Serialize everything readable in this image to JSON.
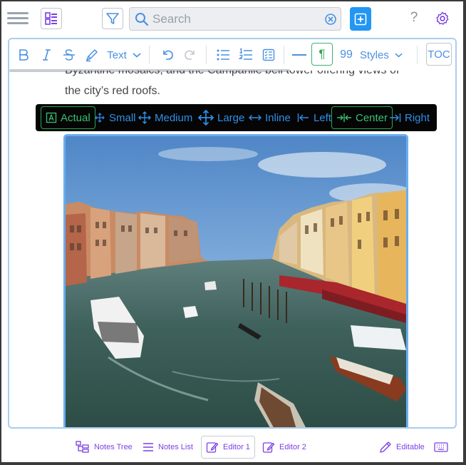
{
  "colors": {
    "accent": "#2196f3",
    "link": "#4a90e2",
    "active": "#2ea44f",
    "bottom": "#7b3fe4"
  },
  "search": {
    "placeholder": "Search"
  },
  "toolbar": {
    "text_label": "Text",
    "styles_label": "Styles",
    "quote_label": "99",
    "toc_label": "TOC"
  },
  "content": {
    "paragraph_partial": "Byzantine mosaics, and the Campanile bell tower offering views of",
    "paragraph_end": "the city’s red roofs."
  },
  "image_toolbar": {
    "actual": "Actual",
    "small": "Small",
    "medium": "Medium",
    "large": "Large",
    "inline": "Inline",
    "left": "Left",
    "center": "Center",
    "right": "Right"
  },
  "bottom": {
    "notes_tree": "Notes Tree",
    "notes_list": "Notes List",
    "editor1": "Editor 1",
    "editor2": "Editor 2",
    "editable": "Editable"
  }
}
